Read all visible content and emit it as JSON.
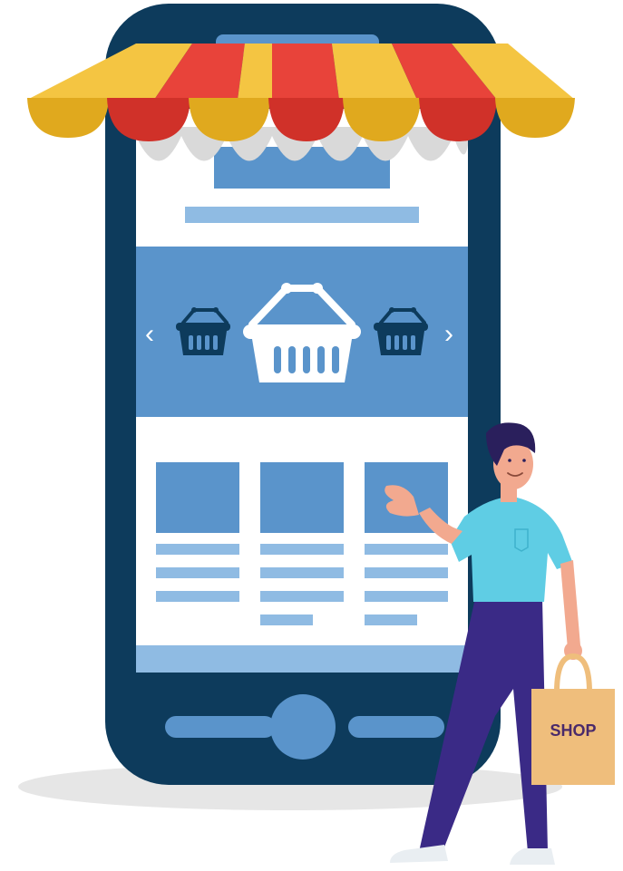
{
  "illustration": {
    "bag_label": "SHOP",
    "carousel": {
      "prev_glyph": "‹",
      "next_glyph": "›",
      "icons": [
        "basket-icon",
        "basket-icon",
        "basket-icon"
      ]
    },
    "product_cards": 3
  },
  "colors": {
    "phone_body": "#0d3b5c",
    "screen_bg": "#ffffff",
    "screen_blue": "#5a94cb",
    "light_blue": "#8fbbe3",
    "awning_yellow": "#f4c542",
    "awning_red": "#e8433a",
    "awning_gray": "#d9d9d9",
    "shirt": "#5fcde4",
    "pants": "#3a2a86",
    "hair": "#2a1f5c",
    "skin": "#f2a98f",
    "bag": "#efbe7c",
    "bag_text": "#4a2a6a",
    "shadow": "#e6e6e6"
  }
}
